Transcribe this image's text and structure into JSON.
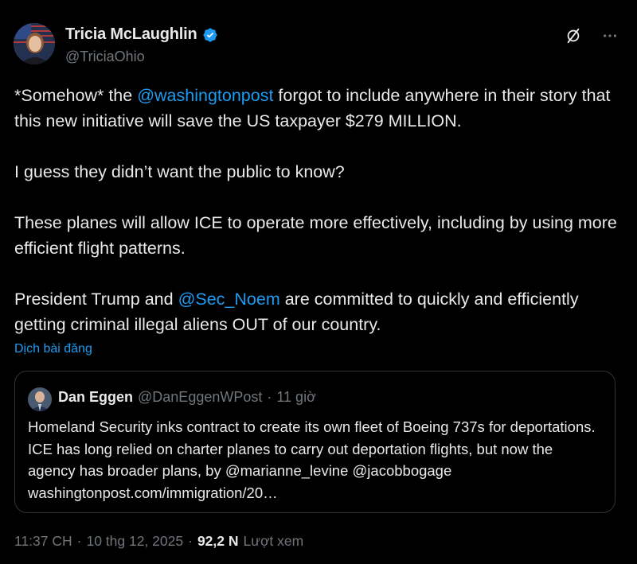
{
  "author": {
    "name": "Tricia McLaughlin",
    "handle": "@TriciaOhio"
  },
  "tweet": {
    "p1_pre": "*Somehow* the ",
    "p1_mention": "@washingtonpost",
    "p1_post": " forgot to include anywhere in their story that this new initiative will save the US taxpayer $279 MILLION.",
    "p2": "I guess they didn’t want the public to know?",
    "p3": "These planes will allow ICE to operate more effectively, including by using more efficient flight patterns.",
    "p4_pre": "President Trump and ",
    "p4_mention": "@Sec_Noem",
    "p4_post": " are committed to quickly and efficiently getting criminal illegal aliens OUT of our country.",
    "translate_label": "Dịch bài đăng"
  },
  "quote": {
    "name": "Dan Eggen",
    "handle": "@DanEggenWPost",
    "separator": "·",
    "time": "11 giờ",
    "text": "Homeland Security inks contract to create its own fleet of Boeing 737s for deportations. ICE has long relied on charter planes to carry out deportation flights, but now the agency has broader plans, by @marianne_levine @jacobbogage washingtonpost.com/immigration/20…"
  },
  "meta": {
    "time": "11:37 CH",
    "separator": "·",
    "date": "10 thg 12, 2025",
    "separator2": "·",
    "views_count": "92,2 N",
    "views_label": "Lượt xem"
  },
  "icons": {
    "verified": "verified-badge-icon",
    "grok": "grok-slash-icon",
    "more": "more-dots-icon"
  },
  "colors": {
    "accent": "#1d9bf0",
    "background": "#000000",
    "text": "#e7e9ea",
    "muted": "#71767b",
    "border": "#2f3336"
  }
}
